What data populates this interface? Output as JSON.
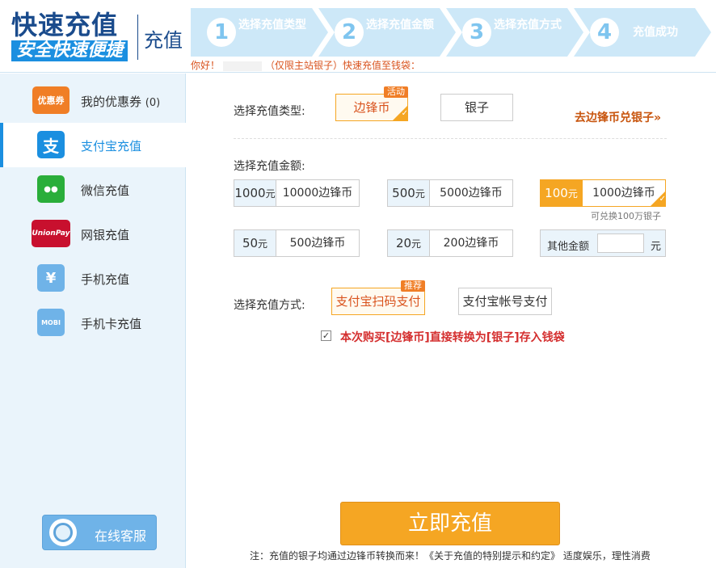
{
  "header": {
    "brand_title": "快速充值",
    "brand_subtitle": "安全快速便捷",
    "recharge_label": "充值",
    "steps": [
      {
        "num": "1",
        "label": "选择充值类型"
      },
      {
        "num": "2",
        "label": "选择充值金额"
      },
      {
        "num": "3",
        "label": "选择充值方式"
      },
      {
        "num": "4",
        "label": "充值成功"
      }
    ],
    "greeting_prefix": "你好！",
    "greeting_suffix": "（仅限主站银子）快速充值至钱袋："
  },
  "sidebar": {
    "items": [
      {
        "label": "我的优惠券",
        "count": "(0)",
        "icon": "coupon-icon",
        "icon_text": "优惠券",
        "icon_color": "#f07e26"
      },
      {
        "label": "支付宝充值",
        "icon": "alipay-icon",
        "icon_text": "支",
        "icon_color": "#1b8fe0"
      },
      {
        "label": "微信充值",
        "icon": "wechat-icon",
        "icon_text": "●●",
        "icon_color": "#2aae3a"
      },
      {
        "label": "网银充值",
        "icon": "unionpay-icon",
        "icon_text": "UnionPay",
        "icon_color": "#c8102e"
      },
      {
        "label": "手机充值",
        "icon": "phone-icon",
        "icon_text": "¥",
        "icon_color": "#6fb3e8"
      },
      {
        "label": "手机卡充值",
        "icon": "phone-card-icon",
        "icon_text": "MOBI",
        "icon_color": "#6fb3e8"
      }
    ],
    "service_label": "在线客服"
  },
  "main": {
    "type_label": "选择充值类型:",
    "types": [
      {
        "label": "边锋币",
        "badge": "活动",
        "selected": true
      },
      {
        "label": "银子",
        "selected": false
      }
    ],
    "exchange_link": "去边锋币兑银子»",
    "amount_label": "选择充值金额:",
    "amounts": [
      {
        "yuan": "1000",
        "unit": "元",
        "coins": "10000边锋币",
        "selected": false
      },
      {
        "yuan": "500",
        "unit": "元",
        "coins": "5000边锋币",
        "selected": false
      },
      {
        "yuan": "100",
        "unit": "元",
        "coins": "1000边锋币",
        "selected": true
      },
      {
        "yuan": "50",
        "unit": "元",
        "coins": "500边锋币",
        "selected": false
      },
      {
        "yuan": "20",
        "unit": "元",
        "coins": "200边锋币",
        "selected": false
      }
    ],
    "exchange_note": "可兑换100万银子",
    "other_label": "其他金额",
    "other_value": "",
    "other_unit": "元",
    "method_label": "选择充值方式:",
    "methods": [
      {
        "label": "支付宝扫码支付",
        "badge": "推荐",
        "selected": true
      },
      {
        "label": "支付宝帐号支付",
        "selected": false
      }
    ],
    "convert_checkbox_mark": "✓",
    "convert_text": "本次购买[边锋币]直接转换为[银子]存入钱袋",
    "submit_label": "立即充值",
    "footer_note": "注：充值的银子均通过边锋币转换而来！《关于充值的特别提示和约定》 适度娱乐，理性消费"
  }
}
